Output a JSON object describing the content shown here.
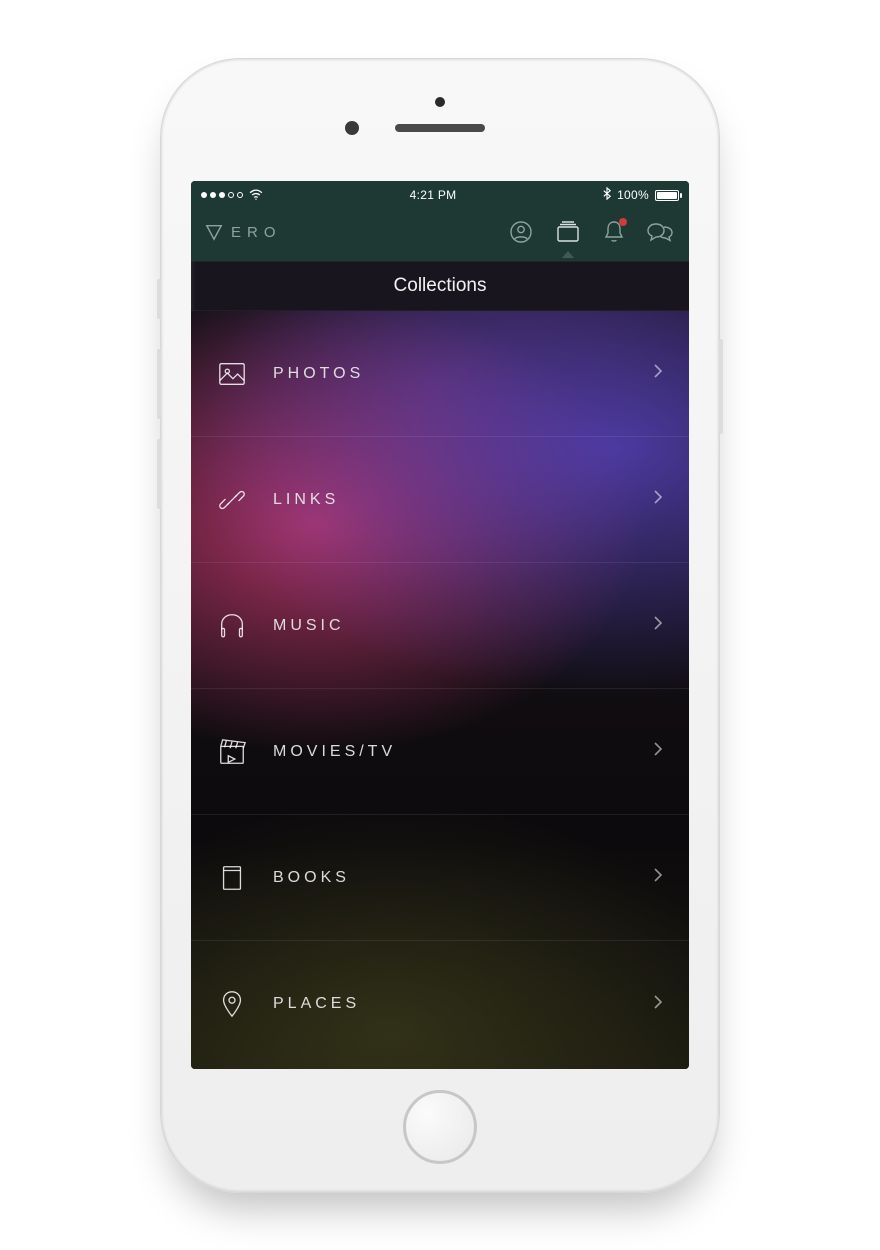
{
  "statusbar": {
    "time": "4:21 PM",
    "battery_pct": "100%"
  },
  "brand": {
    "name": "ERO"
  },
  "page": {
    "title": "Collections"
  },
  "collections": [
    {
      "label": "PHOTOS"
    },
    {
      "label": "LINKS"
    },
    {
      "label": "MUSIC"
    },
    {
      "label": "MOVIES/TV"
    },
    {
      "label": "BOOKS"
    },
    {
      "label": "PLACES"
    }
  ]
}
